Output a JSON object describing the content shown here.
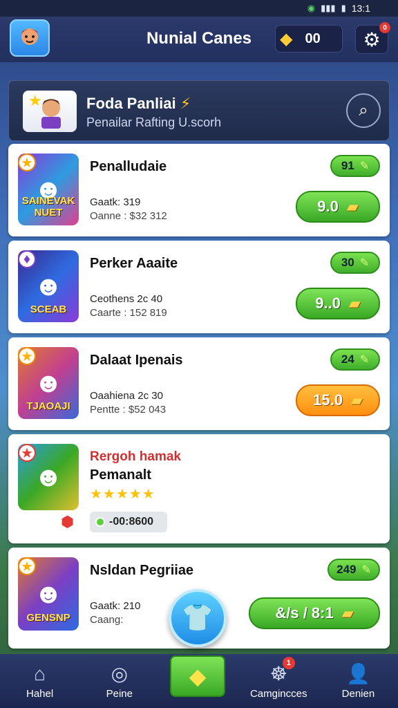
{
  "status_bar": {
    "time": "13:1"
  },
  "header": {
    "title": "Nunial Canes",
    "coins": "00",
    "notification": "0"
  },
  "featured": {
    "title": "Foda Panliai",
    "subtitle": "Penailar Rafting U.scorh"
  },
  "games": [
    {
      "title": "Penalludaie",
      "stat1": "Gaatk: 319",
      "stat2": "Oanne : $32 312",
      "badge": "91",
      "price": "9.0",
      "thumb_text": "SAINEVAK NUET"
    },
    {
      "title": "Perker Aaaite",
      "stat1": "Ceothens 2c 40",
      "stat2": "Caarte : 152 819",
      "badge": "30",
      "price": "9..0",
      "thumb_text": "SCEAB"
    },
    {
      "title": "Dalaat Ipenais",
      "stat1": "Oaahiena 2c 30",
      "stat2": "Pentte : $52 043",
      "badge": "24",
      "price": "15.0",
      "thumb_text": "TJAOAJI"
    },
    {
      "title_red": "Rergoh hamak",
      "title": "Pemanalt",
      "stars": "★★★★★",
      "chip": "-00:8600"
    },
    {
      "title": "Nsldan Pegriiae",
      "stat1": "Gaatk: 210",
      "stat2": "Caang:",
      "badge": "249",
      "price": "&/s / 8:1",
      "thumb_text": "GENSNP"
    }
  ],
  "nav": [
    {
      "label": "Hahel"
    },
    {
      "label": "Peine"
    },
    {
      "label": "Camgincces",
      "badge": "1"
    },
    {
      "label": "Denien"
    }
  ]
}
